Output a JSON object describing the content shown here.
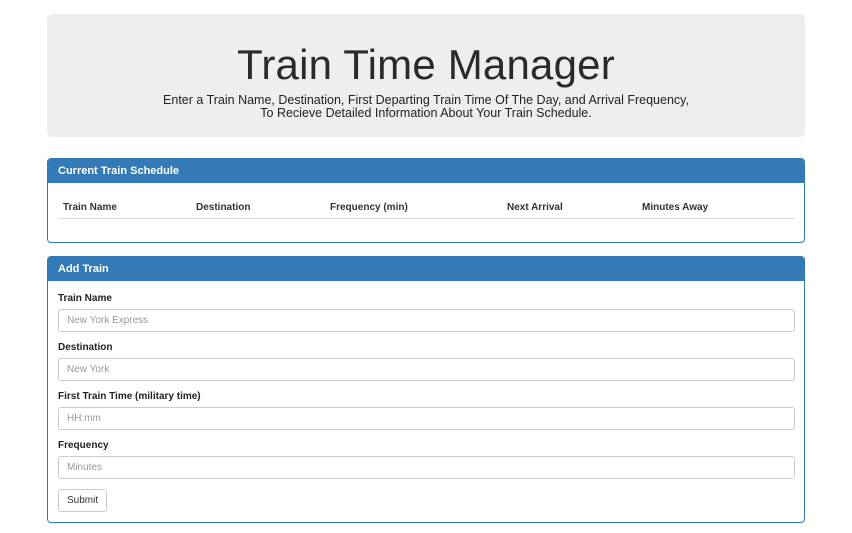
{
  "header": {
    "title": "Train Time Manager",
    "subtitle_line1": "Enter a Train Name, Destination, First Departing Train Time Of The Day, and Arrival Frequency,",
    "subtitle_line2": "To Recieve Detailed Information About Your Train Schedule."
  },
  "schedule": {
    "heading": "Current Train Schedule",
    "columns": [
      "Train Name",
      "Destination",
      "Frequency (min)",
      "Next Arrival",
      "Minutes Away"
    ]
  },
  "add_train": {
    "heading": "Add Train",
    "fields": [
      {
        "label": "Train Name",
        "placeholder": "New York Express"
      },
      {
        "label": "Destination",
        "placeholder": "New York"
      },
      {
        "label": "First Train Time (military time)",
        "placeholder": "HH:mm"
      },
      {
        "label": "Frequency",
        "placeholder": "Minutes"
      }
    ],
    "submit_label": "Submit"
  }
}
